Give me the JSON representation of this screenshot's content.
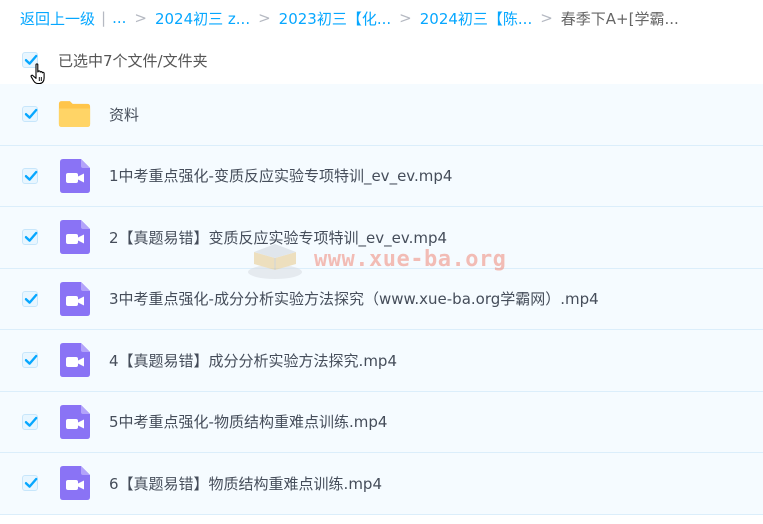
{
  "breadcrumb": {
    "back_label": "返回上一级",
    "ellipsis": "...",
    "crumbs": [
      "2024初三 z...",
      "2023初三【化...",
      "2024初三【陈..."
    ],
    "current": "春季下A+[学霸..."
  },
  "selection": {
    "label": "已选中7个文件/文件夹"
  },
  "files": [
    {
      "name": "资料",
      "type": "folder"
    },
    {
      "name": "1中考重点强化-变质反应实验专项特训_ev_ev.mp4",
      "type": "video"
    },
    {
      "name": "2【真题易错】变质反应实验专项特训_ev_ev.mp4",
      "type": "video"
    },
    {
      "name": "3中考重点强化-成分分析实验方法探究（www.xue-ba.org学霸网）.mp4",
      "type": "video"
    },
    {
      "name": "4【真题易错】成分分析实验方法探究.mp4",
      "type": "video"
    },
    {
      "name": "5中考重点强化-物质结构重难点训练.mp4",
      "type": "video"
    },
    {
      "name": "6【真题易错】物质结构重难点训练.mp4",
      "type": "video"
    }
  ],
  "watermark": {
    "text": "www.xue-ba.org"
  },
  "colors": {
    "accent": "#06a7ff",
    "folder": "#ffc54a",
    "video": "#8a73f5",
    "row_bg": "#f5fbff"
  },
  "icons": {
    "folder": "folder-icon",
    "video": "video-file-icon",
    "check": "checkmark-icon",
    "cursor": "hand-cursor-icon"
  }
}
